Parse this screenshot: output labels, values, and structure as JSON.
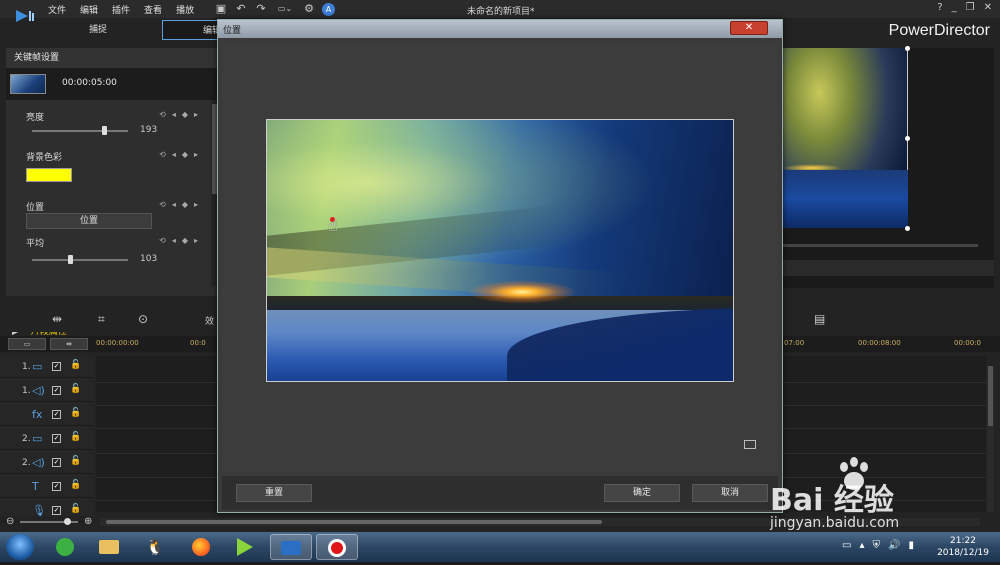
{
  "menu": [
    "文件",
    "编辑",
    "插件",
    "查看",
    "播放"
  ],
  "quick_tools": {
    "badge": "A"
  },
  "document_title": "未命名的新项目*",
  "window_controls": {
    "help": "?",
    "minimize": "_",
    "restore": "❐",
    "close": "✕"
  },
  "brand": "PowerDirector",
  "mode_tabs": [
    {
      "label": "捕捉"
    },
    {
      "label": "编辑",
      "active": true
    }
  ],
  "keyframe_panel": {
    "title": "关键帧设置",
    "clip_time": "00:00:05:00",
    "brightness": {
      "label": "亮度",
      "value": "193",
      "fraction": 0.75
    },
    "bg_color": {
      "label": "背景色彩",
      "color": "#ffff00"
    },
    "position": {
      "label": "位置",
      "button": "位置"
    },
    "average": {
      "label": "平均",
      "value": "103",
      "fraction": 0.4
    },
    "clip_attributes": "片段属性"
  },
  "toolbar": {
    "effects_label": "效"
  },
  "timeline": {
    "ruler_times": [
      "00:00:00:00",
      "00:0",
      "07:00",
      "00:00:08:00",
      "00:00:0"
    ],
    "tracks": [
      {
        "num": "1.",
        "icon": "video-track-icon",
        "glyph": "▭"
      },
      {
        "num": "1.",
        "icon": "audio-track-icon",
        "glyph": "◁)"
      },
      {
        "num": "",
        "icon": "fx-track-icon",
        "glyph": "fx"
      },
      {
        "num": "2.",
        "icon": "video-track-icon",
        "glyph": "▭"
      },
      {
        "num": "2.",
        "icon": "audio-track-icon",
        "glyph": "◁)"
      },
      {
        "num": "",
        "icon": "title-track-icon",
        "glyph": "T"
      },
      {
        "num": "",
        "icon": "voice-track-icon",
        "glyph": "🎙"
      }
    ]
  },
  "dialog": {
    "title": "位置",
    "close": "✕",
    "buttons": {
      "reset": "重置",
      "ok": "确定",
      "cancel": "取消"
    }
  },
  "watermark": {
    "text": "Bai  经验",
    "url": "jingyan.baidu.com"
  },
  "taskbar": {
    "apps": [
      "green-app-icon",
      "file-explorer-icon",
      "qq-icon",
      "firefox-icon",
      "media-player-icon",
      "powerdirector-icon",
      "record-icon"
    ],
    "clock_time": "21:22",
    "clock_date": "2018/12/19"
  }
}
